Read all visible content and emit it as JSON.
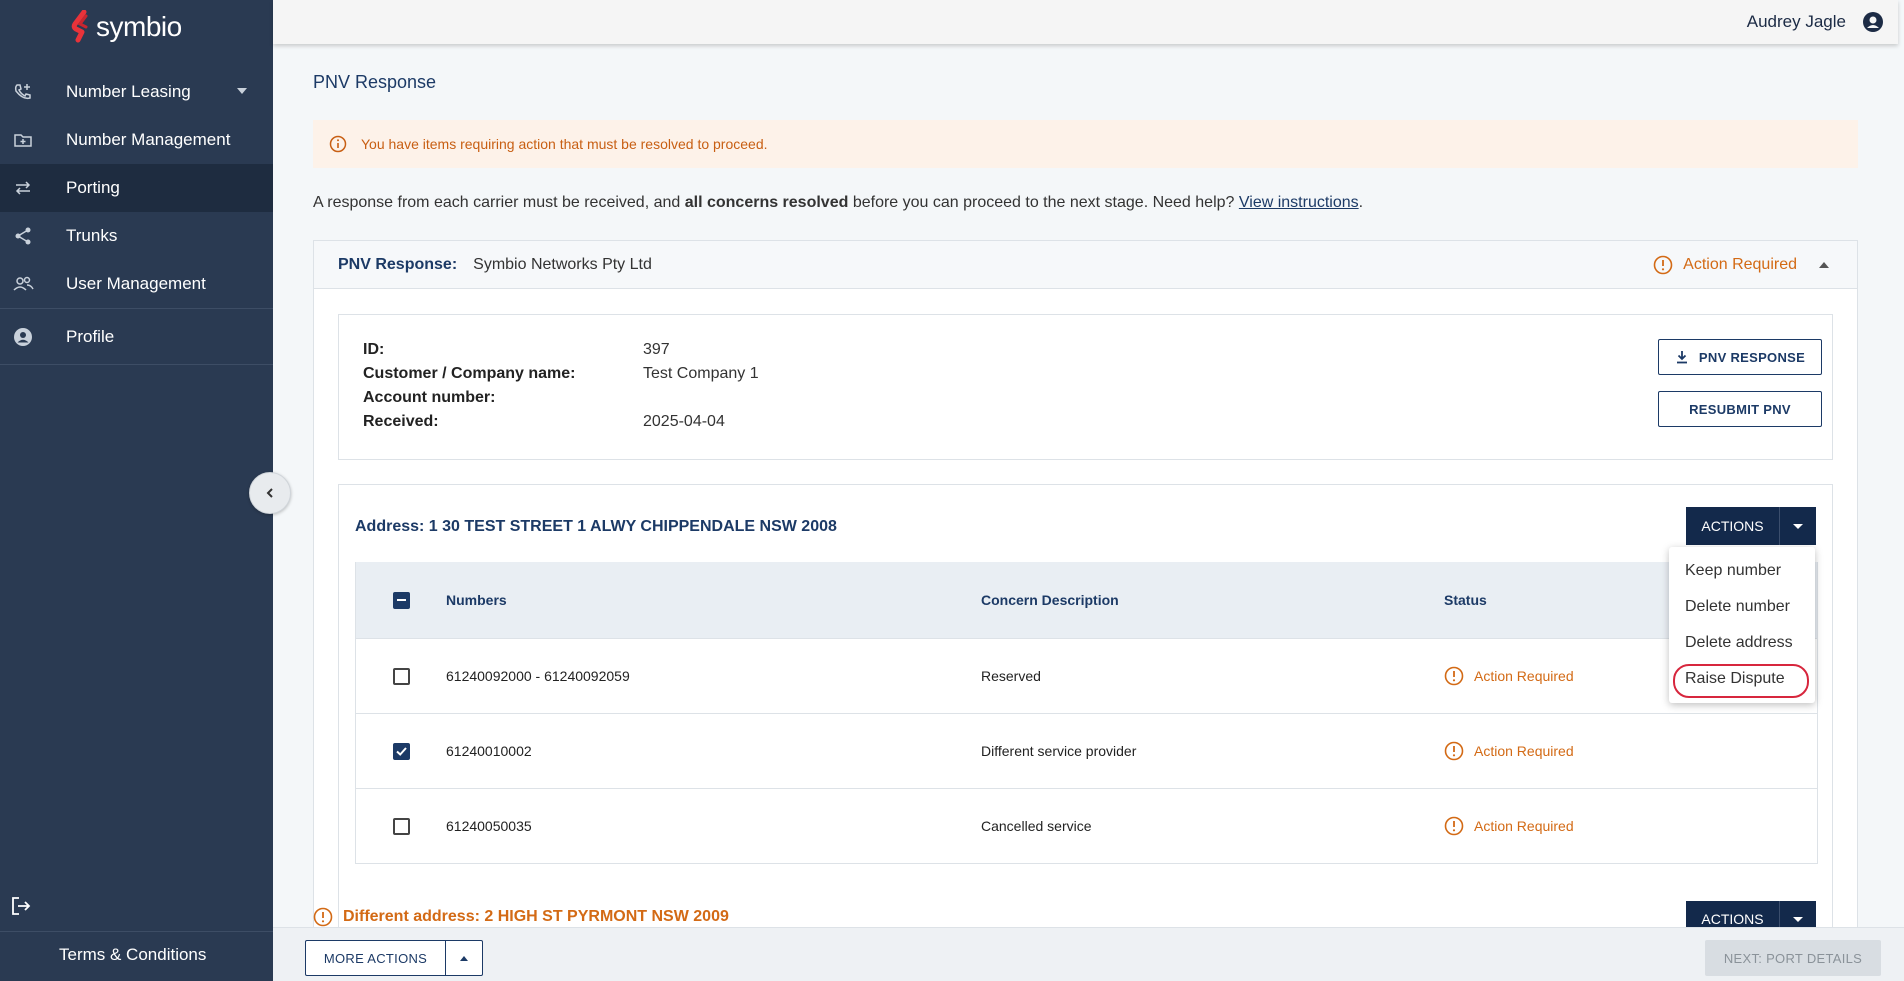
{
  "brand": {
    "name": "symbio",
    "logo_color": "#e8333a"
  },
  "user": {
    "name": "Audrey Jagle",
    "icon": "account-circle-icon"
  },
  "sidebar": {
    "items": [
      {
        "label": "Number Leasing",
        "icon": "phone-add-icon"
      },
      {
        "label": "Number Management",
        "icon": "folder-icon"
      },
      {
        "label": "Porting",
        "icon": "swap-icon"
      },
      {
        "label": "Trunks",
        "icon": "share-icon"
      },
      {
        "label": "User Management",
        "icon": "users-icon"
      },
      {
        "label": "Profile",
        "icon": "account-icon"
      }
    ],
    "active": "Porting",
    "terms": "Terms & Conditions"
  },
  "page": {
    "title": "PNV Response",
    "alert": "You have items requiring action that must be resolved to proceed.",
    "intro_pre": "A response from each carrier must be received, and ",
    "intro_bold": "all concerns resolved",
    "intro_mid": " before you can proceed to the next stage. Need help? ",
    "intro_link": "View instructions",
    "intro_end": "."
  },
  "panel": {
    "label": "PNV Response:",
    "carrier": "Symbio Networks Pty Ltd",
    "status": "Action Required"
  },
  "info": {
    "id_label": "ID:",
    "id": "397",
    "company_label": "Customer / Company name:",
    "company": "Test Company 1",
    "account_label": "Account number:",
    "account": "",
    "received_label": "Received:",
    "received": "2025-04-04",
    "pnv_button": "PNV RESPONSE",
    "resubmit_button": "RESUBMIT PNV"
  },
  "address": {
    "title": "Address: 1 30 TEST STREET 1 ALWY CHIPPENDALE NSW 2008",
    "actions_label": "ACTIONS",
    "columns": {
      "numbers": "Numbers",
      "concern": "Concern Description",
      "status": "Status"
    },
    "rows": [
      {
        "numbers": "61240092000 - 61240092059",
        "concern": "Reserved",
        "status": "Action Required",
        "checked": false
      },
      {
        "numbers": "61240010002",
        "concern": "Different service provider",
        "status": "Action Required",
        "checked": true
      },
      {
        "numbers": "61240050035",
        "concern": "Cancelled service",
        "status": "Action Required",
        "checked": false
      }
    ]
  },
  "dropdown": {
    "items": [
      "Keep number",
      "Delete number",
      "Delete address",
      "Raise Dispute"
    ]
  },
  "address2": {
    "title": "Different address: 2 HIGH ST PYRMONT NSW 2009",
    "actions_label": "ACTIONS"
  },
  "footer": {
    "more_actions": "MORE ACTIONS",
    "next": "NEXT: PORT DETAILS"
  },
  "colors": {
    "sidebar": "#2a3a52",
    "accent": "#13294b",
    "warning": "#d36a15",
    "highlight": "#d7263d"
  }
}
